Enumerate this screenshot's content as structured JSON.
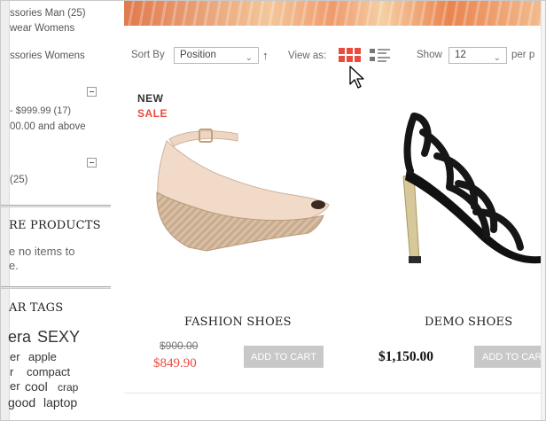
{
  "sidebar": {
    "categories": [
      "ssories Man (25)",
      "wear Womens",
      "ssories Womens"
    ],
    "price_ranges": [
      "- $999.99 (17)",
      "00.00 and above"
    ],
    "extra_count": "(25)",
    "compare_heading": "RE PRODUCTS",
    "compare_empty_line1": "e no items to",
    "compare_empty_line2": "e.",
    "tags_heading": "AR TAGS",
    "tags_row1": [
      "era",
      "SEXY"
    ],
    "tags_row2": [
      "er",
      "apple"
    ],
    "tags_row3": [
      "r",
      "compact"
    ],
    "tags_row4": [
      "er",
      "cool",
      "crap"
    ],
    "tags_row5": [
      "good",
      "laptop"
    ]
  },
  "toolbar": {
    "sort_by_label": "Sort By",
    "sort_value": "Position",
    "sort_direction_arrow": "↑",
    "view_as_label": "View as:",
    "show_label": "Show",
    "show_value": "12",
    "per_page_label": "per p"
  },
  "products": [
    {
      "badge_new": "NEW",
      "badge_sale": "SALE",
      "name": "FASHION SHOES",
      "old_price": "$900.00",
      "price": "$849.90",
      "button": "ADD TO CART"
    },
    {
      "name": "DEMO SHOES",
      "price": "$1,150.00",
      "button": "ADD TO CART"
    }
  ],
  "colors": {
    "accent": "#e84c3d",
    "button_bg": "#c8c8c8"
  },
  "icons": {
    "grid_view": "grid-view-icon",
    "list_view": "list-view-icon",
    "collapse": "minus-icon",
    "cursor": "mouse-pointer-icon"
  }
}
